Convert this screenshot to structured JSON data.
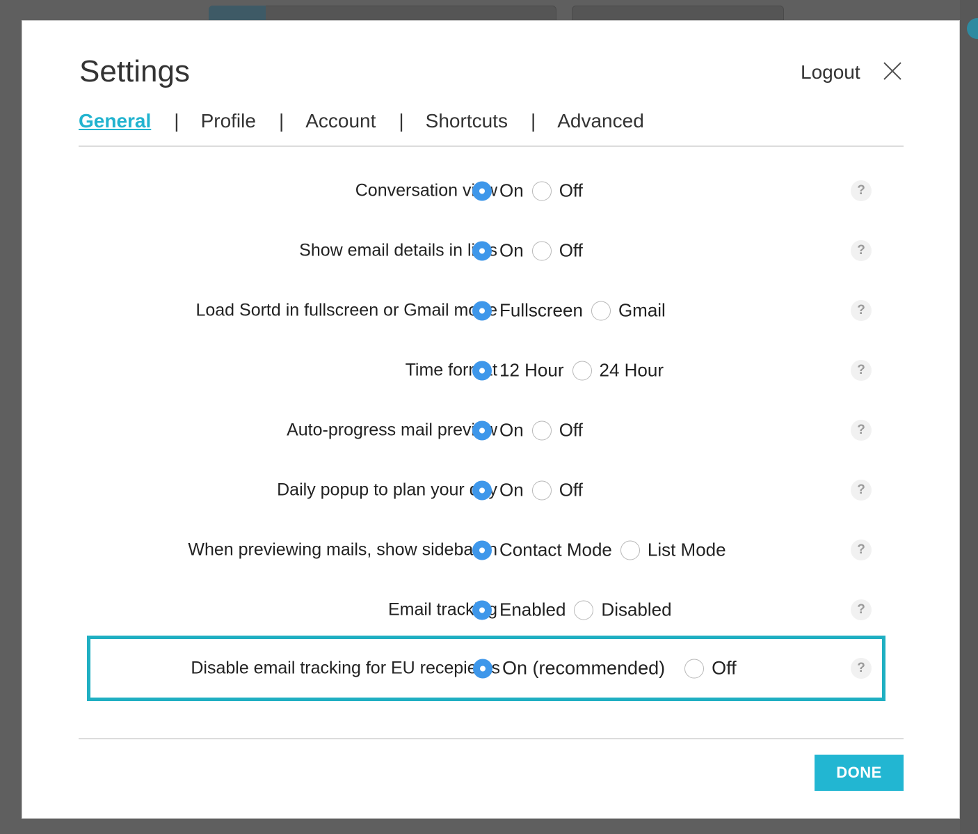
{
  "modal": {
    "title": "Settings",
    "logout_label": "Logout"
  },
  "tabs": [
    {
      "label": "General",
      "active": true
    },
    {
      "label": "Profile",
      "active": false
    },
    {
      "label": "Account",
      "active": false
    },
    {
      "label": "Shortcuts",
      "active": false
    },
    {
      "label": "Advanced",
      "active": false
    }
  ],
  "tab_separator": "|",
  "settings": [
    {
      "label": "Conversation view",
      "options": [
        "On",
        "Off"
      ],
      "selected": 0
    },
    {
      "label": "Show email details in lists",
      "options": [
        "On",
        "Off"
      ],
      "selected": 0
    },
    {
      "label": "Load Sortd in fullscreen or Gmail mode",
      "options": [
        "Fullscreen",
        "Gmail"
      ],
      "selected": 0
    },
    {
      "label": "Time format",
      "options": [
        "12 Hour",
        "24 Hour"
      ],
      "selected": 0
    },
    {
      "label": "Auto-progress mail preview",
      "options": [
        "On",
        "Off"
      ],
      "selected": 0
    },
    {
      "label": "Daily popup to plan your day",
      "options": [
        "On",
        "Off"
      ],
      "selected": 0
    },
    {
      "label": "When previewing mails, show sidebar in",
      "options": [
        "Contact Mode",
        "List Mode"
      ],
      "selected": 0
    },
    {
      "label": "Email tracking",
      "options": [
        "Enabled",
        "Disabled"
      ],
      "selected": 0
    },
    {
      "label": "Disable email tracking for EU recepients",
      "options": [
        "On (recommended)",
        "Off"
      ],
      "selected": 0
    }
  ],
  "help_glyph": "?",
  "done_label": "DONE",
  "colors": {
    "accent": "#21b3cf",
    "radio_checked": "#3e97ea",
    "highlight_border": "#1fafc2"
  }
}
